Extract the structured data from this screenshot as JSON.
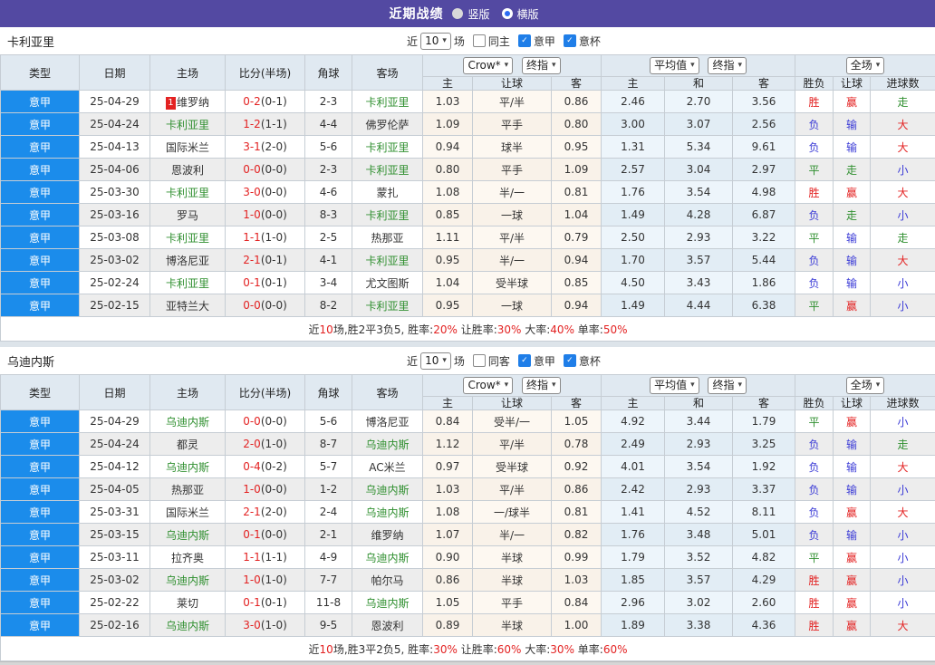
{
  "topbar": {
    "title": "近期战绩",
    "radios": [
      {
        "label": "竖版",
        "selected": false
      },
      {
        "label": "横版",
        "selected": true
      }
    ]
  },
  "colors": {
    "topbar_bg": "#5349a2",
    "league_cell_bg": "#1b8ceb",
    "self_team_green": "#2f8f2f",
    "score_red": "#e32222",
    "lose_blue": "#3a3ad6",
    "header_bg": "#e0e9f1"
  },
  "result_colors": {
    "胜": "#e32222",
    "赢": "#e32222",
    "大": "#e32222",
    "平": "#2f8f2f",
    "走": "#2f8f2f",
    "负": "#3a3ad6",
    "输": "#3a3ad6",
    "小": "#3a3ad6"
  },
  "table_header": {
    "cols": [
      "类型",
      "日期",
      "主场",
      "比分(半场)",
      "角球",
      "客场"
    ],
    "sub": [
      "主",
      "让球",
      "客",
      "主",
      "和",
      "客",
      "胜负",
      "让球",
      "进球数"
    ],
    "selects": {
      "odds_primary": "Crow*",
      "odds_secondary": "终指",
      "avg_primary": "平均值",
      "avg_secondary": "终指",
      "scope": "全场"
    }
  },
  "sections": [
    {
      "team": "卡利亚里",
      "filter": {
        "near": "近",
        "count": "10",
        "unit": "场",
        "checks": [
          {
            "label": "同主",
            "checked": false
          },
          {
            "label": "意甲",
            "checked": true
          },
          {
            "label": "意杯",
            "checked": true
          }
        ]
      },
      "rows": [
        {
          "league": "意甲",
          "date": "25-04-29",
          "home": "维罗纳",
          "home_badge": "1",
          "home_self": false,
          "score": "0-2",
          "half": "(0-1)",
          "corner": "2-3",
          "away": "卡利亚里",
          "away_self": true,
          "odds": [
            "1.03",
            "平/半",
            "0.86"
          ],
          "avg": [
            "2.46",
            "2.70",
            "3.56"
          ],
          "results": [
            "胜",
            "赢",
            "走"
          ]
        },
        {
          "league": "意甲",
          "date": "25-04-24",
          "home": "卡利亚里",
          "home_self": true,
          "score": "1-2",
          "half": "(1-1)",
          "corner": "4-4",
          "away": "佛罗伦萨",
          "away_self": false,
          "odds": [
            "1.09",
            "平手",
            "0.80"
          ],
          "avg": [
            "3.00",
            "3.07",
            "2.56"
          ],
          "results": [
            "负",
            "输",
            "大"
          ]
        },
        {
          "league": "意甲",
          "date": "25-04-13",
          "home": "国际米兰",
          "home_self": false,
          "score": "3-1",
          "half": "(2-0)",
          "corner": "5-6",
          "away": "卡利亚里",
          "away_self": true,
          "odds": [
            "0.94",
            "球半",
            "0.95"
          ],
          "avg": [
            "1.31",
            "5.34",
            "9.61"
          ],
          "results": [
            "负",
            "输",
            "大"
          ]
        },
        {
          "league": "意甲",
          "date": "25-04-06",
          "home": "恩波利",
          "home_self": false,
          "score": "0-0",
          "half": "(0-0)",
          "corner": "2-3",
          "away": "卡利亚里",
          "away_self": true,
          "odds": [
            "0.80",
            "平手",
            "1.09"
          ],
          "avg": [
            "2.57",
            "3.04",
            "2.97"
          ],
          "results": [
            "平",
            "走",
            "小"
          ]
        },
        {
          "league": "意甲",
          "date": "25-03-30",
          "home": "卡利亚里",
          "home_self": true,
          "score": "3-0",
          "half": "(0-0)",
          "corner": "4-6",
          "away": "蒙扎",
          "away_self": false,
          "odds": [
            "1.08",
            "半/一",
            "0.81"
          ],
          "avg": [
            "1.76",
            "3.54",
            "4.98"
          ],
          "results": [
            "胜",
            "赢",
            "大"
          ]
        },
        {
          "league": "意甲",
          "date": "25-03-16",
          "home": "罗马",
          "home_self": false,
          "score": "1-0",
          "half": "(0-0)",
          "corner": "8-3",
          "away": "卡利亚里",
          "away_self": true,
          "odds": [
            "0.85",
            "一球",
            "1.04"
          ],
          "avg": [
            "1.49",
            "4.28",
            "6.87"
          ],
          "results": [
            "负",
            "走",
            "小"
          ]
        },
        {
          "league": "意甲",
          "date": "25-03-08",
          "home": "卡利亚里",
          "home_self": true,
          "score": "1-1",
          "half": "(1-0)",
          "corner": "2-5",
          "away": "热那亚",
          "away_self": false,
          "odds": [
            "1.11",
            "平/半",
            "0.79"
          ],
          "avg": [
            "2.50",
            "2.93",
            "3.22"
          ],
          "results": [
            "平",
            "输",
            "走"
          ]
        },
        {
          "league": "意甲",
          "date": "25-03-02",
          "home": "博洛尼亚",
          "home_self": false,
          "score": "2-1",
          "half": "(0-1)",
          "corner": "4-1",
          "away": "卡利亚里",
          "away_self": true,
          "odds": [
            "0.95",
            "半/一",
            "0.94"
          ],
          "avg": [
            "1.70",
            "3.57",
            "5.44"
          ],
          "results": [
            "负",
            "输",
            "大"
          ]
        },
        {
          "league": "意甲",
          "date": "25-02-24",
          "home": "卡利亚里",
          "home_self": true,
          "score": "0-1",
          "half": "(0-1)",
          "corner": "3-4",
          "away": "尤文图斯",
          "away_self": false,
          "odds": [
            "1.04",
            "受半球",
            "0.85"
          ],
          "avg": [
            "4.50",
            "3.43",
            "1.86"
          ],
          "results": [
            "负",
            "输",
            "小"
          ]
        },
        {
          "league": "意甲",
          "date": "25-02-15",
          "home": "亚特兰大",
          "home_self": false,
          "score": "0-0",
          "half": "(0-0)",
          "corner": "8-2",
          "away": "卡利亚里",
          "away_self": true,
          "odds": [
            "0.95",
            "一球",
            "0.94"
          ],
          "avg": [
            "1.49",
            "4.44",
            "6.38"
          ],
          "results": [
            "平",
            "赢",
            "小"
          ]
        }
      ],
      "summary": [
        {
          "t": "近",
          "red": false
        },
        {
          "t": "10",
          "red": true
        },
        {
          "t": "场,胜2平3负5, 胜率:",
          "red": false
        },
        {
          "t": "20%",
          "red": true
        },
        {
          "t": " 让胜率:",
          "red": false
        },
        {
          "t": "30%",
          "red": true
        },
        {
          "t": " 大率:",
          "red": false
        },
        {
          "t": "40%",
          "red": true
        },
        {
          "t": " 单率:",
          "red": false
        },
        {
          "t": "50%",
          "red": true
        }
      ]
    },
    {
      "team": "乌迪内斯",
      "filter": {
        "near": "近",
        "count": "10",
        "unit": "场",
        "checks": [
          {
            "label": "同客",
            "checked": false
          },
          {
            "label": "意甲",
            "checked": true
          },
          {
            "label": "意杯",
            "checked": true
          }
        ]
      },
      "rows": [
        {
          "league": "意甲",
          "date": "25-04-29",
          "home": "乌迪内斯",
          "home_self": true,
          "score": "0-0",
          "half": "(0-0)",
          "corner": "5-6",
          "away": "博洛尼亚",
          "away_self": false,
          "odds": [
            "0.84",
            "受半/一",
            "1.05"
          ],
          "avg": [
            "4.92",
            "3.44",
            "1.79"
          ],
          "results": [
            "平",
            "赢",
            "小"
          ]
        },
        {
          "league": "意甲",
          "date": "25-04-24",
          "home": "都灵",
          "home_self": false,
          "score": "2-0",
          "half": "(1-0)",
          "corner": "8-7",
          "away": "乌迪内斯",
          "away_self": true,
          "odds": [
            "1.12",
            "平/半",
            "0.78"
          ],
          "avg": [
            "2.49",
            "2.93",
            "3.25"
          ],
          "results": [
            "负",
            "输",
            "走"
          ]
        },
        {
          "league": "意甲",
          "date": "25-04-12",
          "home": "乌迪内斯",
          "home_self": true,
          "score": "0-4",
          "half": "(0-2)",
          "corner": "5-7",
          "away": "AC米兰",
          "away_self": false,
          "odds": [
            "0.97",
            "受半球",
            "0.92"
          ],
          "avg": [
            "4.01",
            "3.54",
            "1.92"
          ],
          "results": [
            "负",
            "输",
            "大"
          ]
        },
        {
          "league": "意甲",
          "date": "25-04-05",
          "home": "热那亚",
          "home_self": false,
          "score": "1-0",
          "half": "(0-0)",
          "corner": "1-2",
          "away": "乌迪内斯",
          "away_self": true,
          "odds": [
            "1.03",
            "平/半",
            "0.86"
          ],
          "avg": [
            "2.42",
            "2.93",
            "3.37"
          ],
          "results": [
            "负",
            "输",
            "小"
          ]
        },
        {
          "league": "意甲",
          "date": "25-03-31",
          "home": "国际米兰",
          "home_self": false,
          "score": "2-1",
          "half": "(2-0)",
          "corner": "2-4",
          "away": "乌迪内斯",
          "away_self": true,
          "odds": [
            "1.08",
            "一/球半",
            "0.81"
          ],
          "avg": [
            "1.41",
            "4.52",
            "8.11"
          ],
          "results": [
            "负",
            "赢",
            "大"
          ]
        },
        {
          "league": "意甲",
          "date": "25-03-15",
          "home": "乌迪内斯",
          "home_self": true,
          "score": "0-1",
          "half": "(0-0)",
          "corner": "2-1",
          "away": "维罗纳",
          "away_self": false,
          "odds": [
            "1.07",
            "半/一",
            "0.82"
          ],
          "avg": [
            "1.76",
            "3.48",
            "5.01"
          ],
          "results": [
            "负",
            "输",
            "小"
          ]
        },
        {
          "league": "意甲",
          "date": "25-03-11",
          "home": "拉齐奥",
          "home_self": false,
          "score": "1-1",
          "half": "(1-1)",
          "corner": "4-9",
          "away": "乌迪内斯",
          "away_self": true,
          "odds": [
            "0.90",
            "半球",
            "0.99"
          ],
          "avg": [
            "1.79",
            "3.52",
            "4.82"
          ],
          "results": [
            "平",
            "赢",
            "小"
          ]
        },
        {
          "league": "意甲",
          "date": "25-03-02",
          "home": "乌迪内斯",
          "home_self": true,
          "score": "1-0",
          "half": "(1-0)",
          "corner": "7-7",
          "away": "帕尔马",
          "away_self": false,
          "odds": [
            "0.86",
            "半球",
            "1.03"
          ],
          "avg": [
            "1.85",
            "3.57",
            "4.29"
          ],
          "results": [
            "胜",
            "赢",
            "小"
          ]
        },
        {
          "league": "意甲",
          "date": "25-02-22",
          "home": "莱切",
          "home_self": false,
          "score": "0-1",
          "half": "(0-1)",
          "corner": "11-8",
          "away": "乌迪内斯",
          "away_self": true,
          "odds": [
            "1.05",
            "平手",
            "0.84"
          ],
          "avg": [
            "2.96",
            "3.02",
            "2.60"
          ],
          "results": [
            "胜",
            "赢",
            "小"
          ]
        },
        {
          "league": "意甲",
          "date": "25-02-16",
          "home": "乌迪内斯",
          "home_self": true,
          "score": "3-0",
          "half": "(1-0)",
          "corner": "9-5",
          "away": "恩波利",
          "away_self": false,
          "odds": [
            "0.89",
            "半球",
            "1.00"
          ],
          "avg": [
            "1.89",
            "3.38",
            "4.36"
          ],
          "results": [
            "胜",
            "赢",
            "大"
          ]
        }
      ],
      "summary": [
        {
          "t": "近",
          "red": false
        },
        {
          "t": "10",
          "red": true
        },
        {
          "t": "场,胜3平2负5, 胜率:",
          "red": false
        },
        {
          "t": "30%",
          "red": true
        },
        {
          "t": " 让胜率:",
          "red": false
        },
        {
          "t": "60%",
          "red": true
        },
        {
          "t": " 大率:",
          "red": false
        },
        {
          "t": "30%",
          "red": true
        },
        {
          "t": " 单率:",
          "red": false
        },
        {
          "t": "60%",
          "red": true
        }
      ]
    }
  ]
}
